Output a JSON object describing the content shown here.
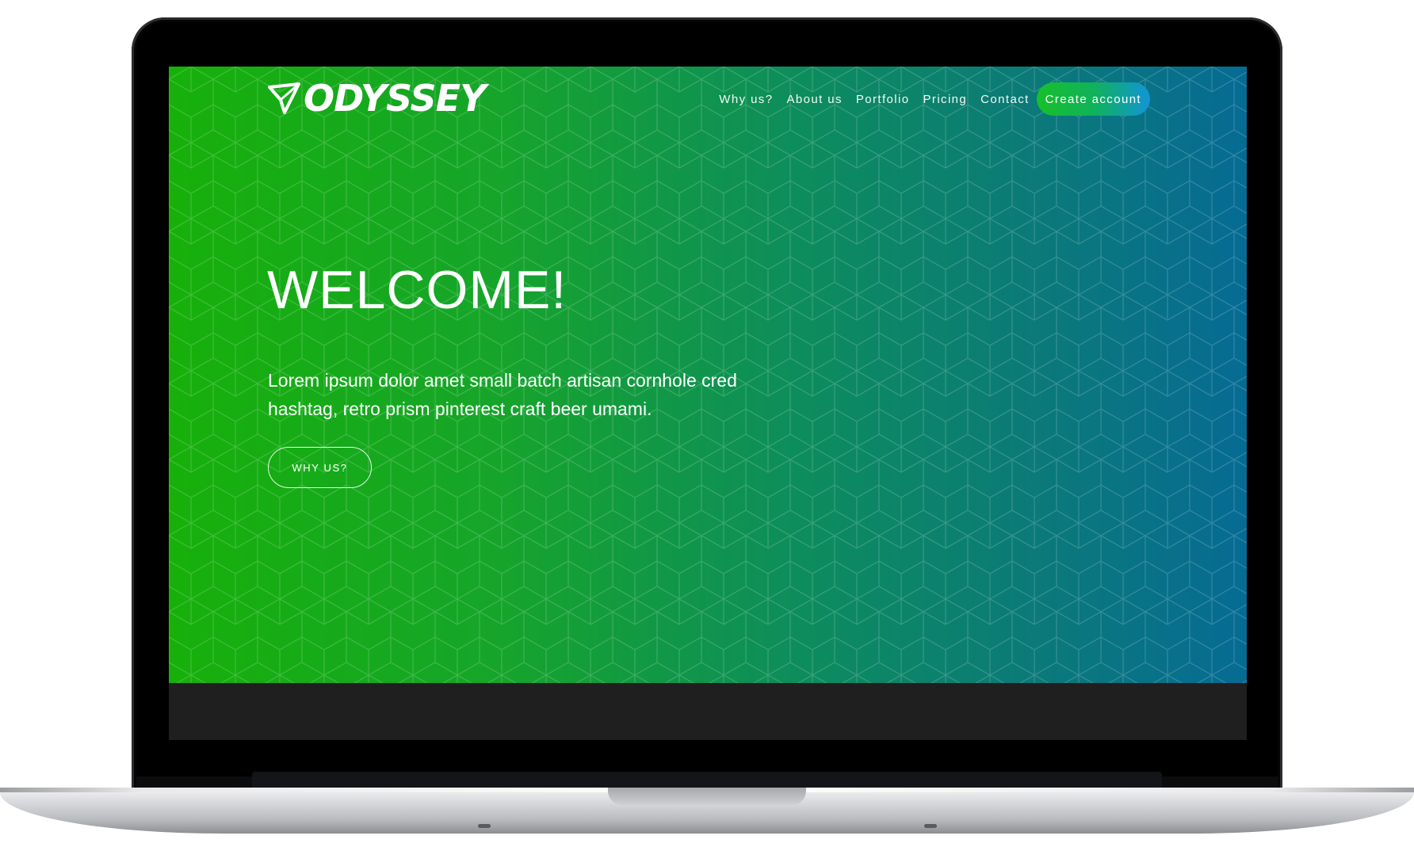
{
  "brand": {
    "name": "ODYSSEY",
    "icon": "paper-plane-icon"
  },
  "nav": {
    "links": [
      "Why us?",
      "About us",
      "Portfolio",
      "Pricing",
      "Contact"
    ],
    "cta_label": "Create account"
  },
  "hero": {
    "title": "WELCOME!",
    "text": "Lorem ipsum dolor amet small batch artisan cornhole cred hashtag, retro prism pinterest craft beer umami.",
    "button_label": "WHY US?"
  },
  "colors": {
    "gradient_start": "#17b00a",
    "gradient_end": "#066b94",
    "cta_start": "#16c02a",
    "cta_end": "#1294d8",
    "footer": "#1f1f1f"
  }
}
